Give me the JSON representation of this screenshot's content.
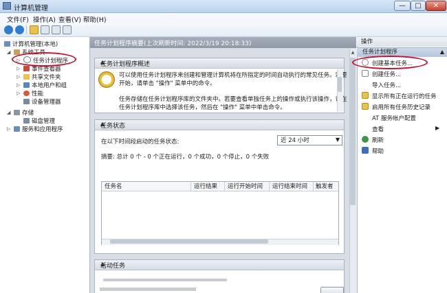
{
  "window": {
    "title": "计算机管理",
    "min": "—",
    "max": "□",
    "close": "✕"
  },
  "menu": [
    "文件(F)",
    "操作(A)",
    "查看(V)",
    "帮助(H)"
  ],
  "tree": {
    "root": "计算机管理(本地)",
    "system_tools": "系统工具",
    "task_scheduler": "任务计划程序",
    "event_viewer": "事件查看器",
    "shared_folders": "共享文件夹",
    "local_users": "本地用户和组",
    "performance": "性能",
    "device_manager": "设备管理器",
    "storage": "存储",
    "disk_management": "磁盘管理",
    "services": "服务和应用程序"
  },
  "center": {
    "header": "任务计划程序摘要(上次刷新时间: 2022/3/19 20:18:33)",
    "overview_title": "任务计划程序概述",
    "overview_p1_l1": "可以使用任务计划程序来创建和管理计算机将在所指定的时间自动执行的常见任务。若要",
    "overview_p1_l2": "开始，请单击 \"操作\" 菜单中的命令。",
    "overview_p2_l1": "任务存储在任务计划程序库的文件夹中。若要查看单独任务上的操作或执行该操作，请在",
    "overview_p2_l2": "任务计划程序库中选择该任务，然后在 \"操作\" 菜单中单击命令。",
    "status_title": "任务状态",
    "status_label": "在以下时间段启动的任务状态:",
    "period_value": "近 24 小时",
    "summary": "摘要: 总计 0 个 - 0 个正在运行，0 个成功，0 个停止，0 个失败",
    "columns": [
      "任务名",
      "运行结果",
      "运行开始时间",
      "运行结束时间",
      "触发者"
    ],
    "active_title": "活动任务"
  },
  "actions": {
    "header": "操作",
    "section": "任务计划程序",
    "items": [
      "创建基本任务...",
      "创建任务...",
      "导入任务...",
      "显示所有正在运行的任务",
      "启用所有任务历史记录",
      "AT 服务帐户配置",
      "查看",
      "刷新",
      "帮助"
    ]
  }
}
